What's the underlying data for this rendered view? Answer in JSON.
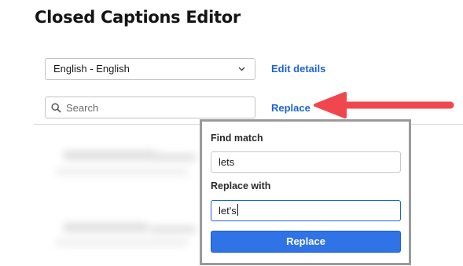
{
  "page": {
    "title": "Closed Captions Editor"
  },
  "toolbar": {
    "language_selected": "English - English",
    "edit_details_label": "Edit details",
    "search_placeholder": "Search",
    "replace_link_label": "Replace"
  },
  "replace_popup": {
    "find_label": "Find match",
    "find_value": "lets",
    "replace_label": "Replace with",
    "replace_value": "let's",
    "submit_label": "Replace"
  },
  "colors": {
    "accent": "#1e63d6",
    "button": "#2f73e6",
    "annotation_arrow": "#f0474f"
  },
  "icons": [
    "chevron-down-icon",
    "search-icon",
    "arrow-annotation"
  ]
}
